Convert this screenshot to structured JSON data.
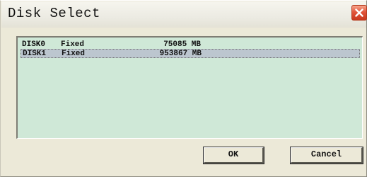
{
  "window": {
    "title": "Disk Select",
    "close_icon": "close-x-icon"
  },
  "disk_list": {
    "selected_index": 1,
    "rows": [
      {
        "name": "DISK0",
        "type": "Fixed",
        "size": "75085 MB"
      },
      {
        "name": "DISK1",
        "type": "Fixed",
        "size": "953867 MB"
      }
    ]
  },
  "buttons": {
    "ok_label": "OK",
    "cancel_label": "Cancel"
  },
  "colors": {
    "list_background": "#cfe8d7",
    "selected_row": "#bcc6cf",
    "dialog_face": "#ece9d8",
    "close_button": "#d9472b"
  }
}
